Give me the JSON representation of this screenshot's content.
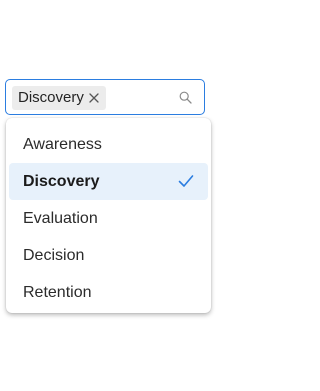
{
  "combobox": {
    "selected_chip": "Discovery",
    "chip_remove_icon": "close-icon",
    "search_icon": "search-icon",
    "accent_color": "#2b7de0"
  },
  "dropdown": {
    "options": [
      {
        "label": "Awareness",
        "selected": false
      },
      {
        "label": "Discovery",
        "selected": true
      },
      {
        "label": "Evaluation",
        "selected": false
      },
      {
        "label": "Decision",
        "selected": false
      },
      {
        "label": "Retention",
        "selected": false
      }
    ],
    "selected_icon": "checkmark-icon",
    "selected_background": "#e7f1fb",
    "check_color": "#2b7de0"
  }
}
